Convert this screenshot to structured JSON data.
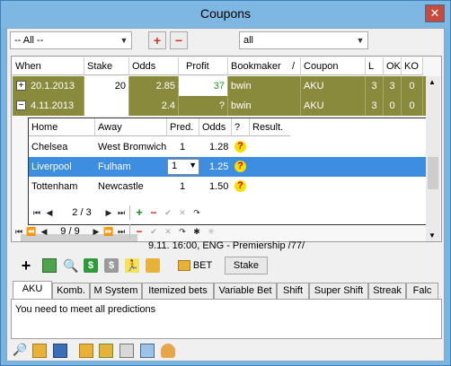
{
  "window": {
    "title": "Coupons",
    "close_label": "✕"
  },
  "toolbar": {
    "filter1": "-- All --",
    "add_label": "+",
    "remove_label": "−",
    "filter2": "all"
  },
  "grid": {
    "columns": [
      "When",
      "Stake",
      "Odds",
      "Profit",
      "Bookmaker",
      "Coupon",
      "L",
      "OK",
      "KO"
    ],
    "sort_indicator": "/",
    "rows": [
      {
        "expander": "+",
        "when": "20.1.2013",
        "stake": "20",
        "odds": "2.85",
        "profit": "37",
        "bookmaker": "bwin",
        "coupon": "AKU",
        "l": "3",
        "ok": "3",
        "ko": "0"
      },
      {
        "expander": "−",
        "when": "4.11.2013",
        "stake": "",
        "odds": "2.4",
        "profit": "?",
        "bookmaker": "bwin",
        "coupon": "AKU",
        "l": "3",
        "ok": "0",
        "ko": "0"
      }
    ]
  },
  "subgrid": {
    "columns": [
      "Home",
      "Away",
      "Pred.",
      "Odds",
      "?",
      "Result."
    ],
    "rows": [
      {
        "home": "Chelsea",
        "away": "West Bromwich",
        "pred": "1",
        "odds": "1.28",
        "q": "?"
      },
      {
        "home": "Liverpool",
        "away": "Fulham",
        "pred": "1",
        "odds": "1.25",
        "q": "?"
      },
      {
        "home": "Tottenham",
        "away": "Newcastle",
        "pred": "1",
        "odds": "1.50",
        "q": "?"
      }
    ],
    "nav_position": "2 / 3"
  },
  "main_nav": {
    "position": "9 / 9"
  },
  "match_info": "9.11. 16:00, ENG - Premiership /77/",
  "actions": {
    "bet_label": "BET",
    "stake_label": "Stake"
  },
  "tabs": [
    "AKU",
    "Komb.",
    "M System",
    "Itemized bets",
    "Variable Bet",
    "Shift",
    "Super Shift",
    "Streak",
    "Falc"
  ],
  "tab_content": "You need to meet all predictions",
  "colors": {
    "row_bg": "#8a8a3c",
    "selection": "#3d8ee0",
    "profit_green": "#1e9f1e",
    "title_bar": "#7fb7e3"
  }
}
